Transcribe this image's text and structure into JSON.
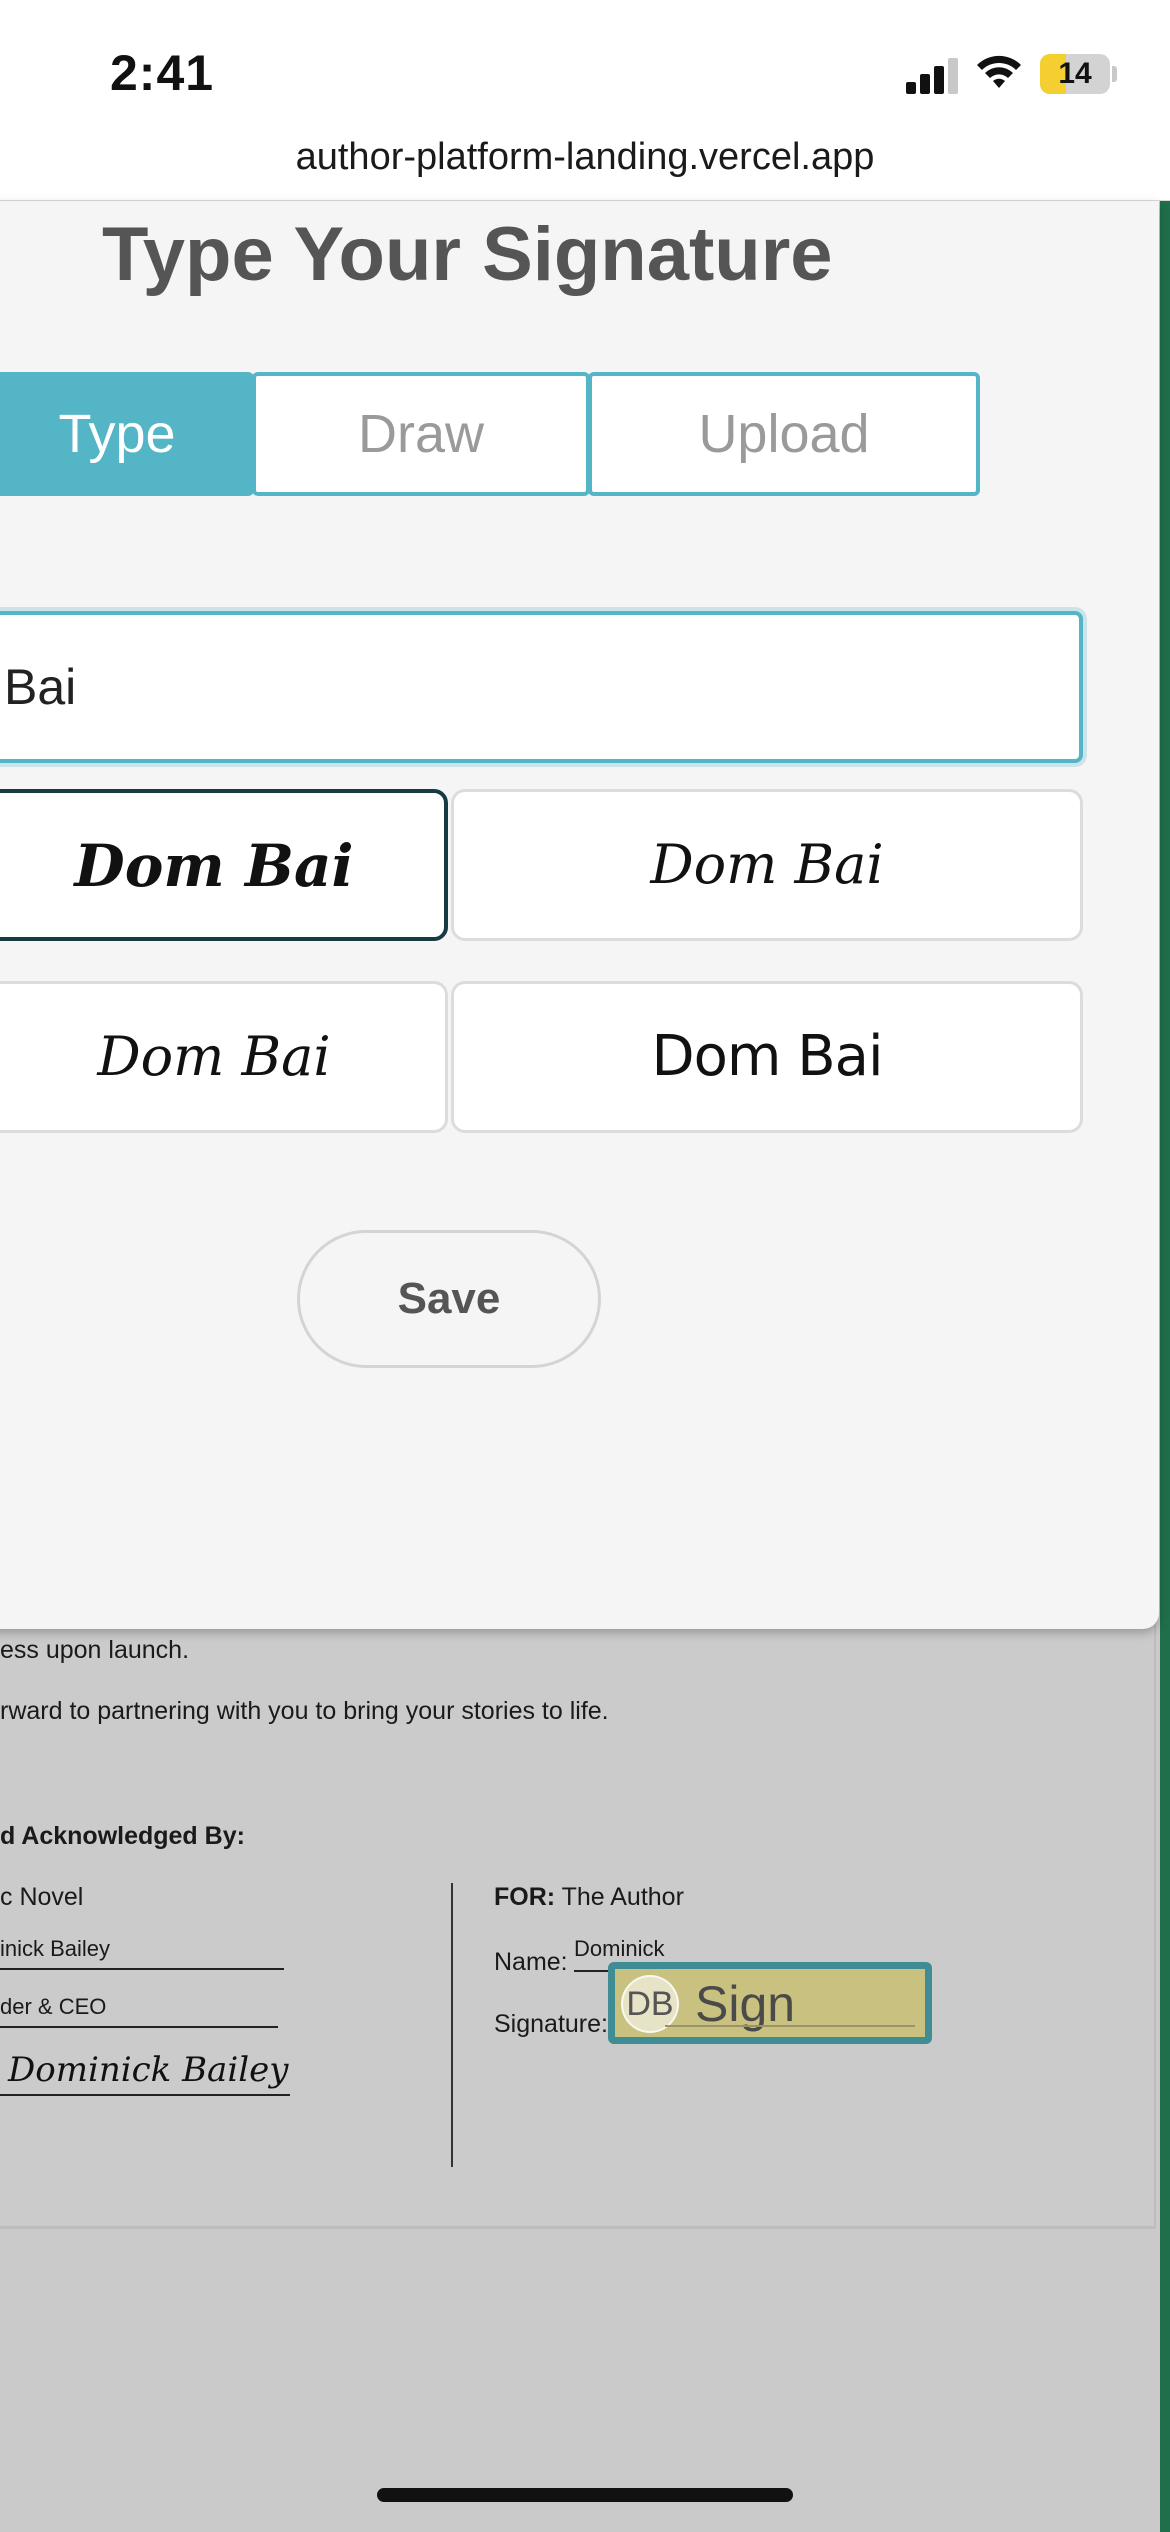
{
  "status_bar": {
    "time": "2:41",
    "battery": "14",
    "battery_color": "#f5cf2f"
  },
  "browser": {
    "url": "author-platform-landing.vercel.app"
  },
  "modal": {
    "title": "Type Your Signature",
    "tabs": [
      {
        "label": "Type",
        "active": true
      },
      {
        "label": "Draw",
        "active": false
      },
      {
        "label": "Upload",
        "active": false
      }
    ],
    "name_input_value": "Bai",
    "signature_styles": [
      {
        "text": "Dom Bai",
        "selected": true
      },
      {
        "text": "Dom Bai",
        "selected": false
      },
      {
        "text": "Dom Bai",
        "selected": false
      },
      {
        "text": "Dom Bai",
        "selected": false
      }
    ],
    "save_label": "Save",
    "accent_color": "#53b5c6"
  },
  "document": {
    "line1": "ess upon launch.",
    "line2": "rward to partnering with you to bring your stories to life.",
    "ack_heading": "d Acknowledged By:",
    "left": {
      "org": "c Novel",
      "name": "inick Bailey",
      "title": "der & CEO",
      "signature": "Dominick Bailey"
    },
    "right": {
      "for_label": "FOR:",
      "for_value": "The Author",
      "name_label": "Name:",
      "name_value": "Dominick",
      "signature_label": "Signature:",
      "sign_initials": "DB",
      "sign_button": "Sign"
    }
  }
}
